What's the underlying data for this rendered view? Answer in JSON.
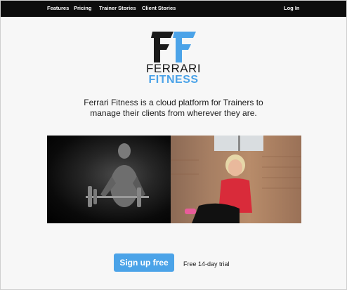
{
  "nav": {
    "features": "Features",
    "pricing": "Pricing",
    "trainer_stories": "Trainer Stories",
    "client_stories": "Client Stories",
    "login": "Log In"
  },
  "logo": {
    "line1": "FERRARI",
    "line2": "FITNESS",
    "colors": {
      "black": "#1a1a1a",
      "blue": "#4ba3e8"
    }
  },
  "tagline": "Ferrari Fitness is a cloud platform for Trainers to manage their clients from wherever they are.",
  "cta": {
    "button_label": "Sign up free",
    "trial_note": "Free 14-day trial",
    "button_color": "#4ba3e8"
  }
}
